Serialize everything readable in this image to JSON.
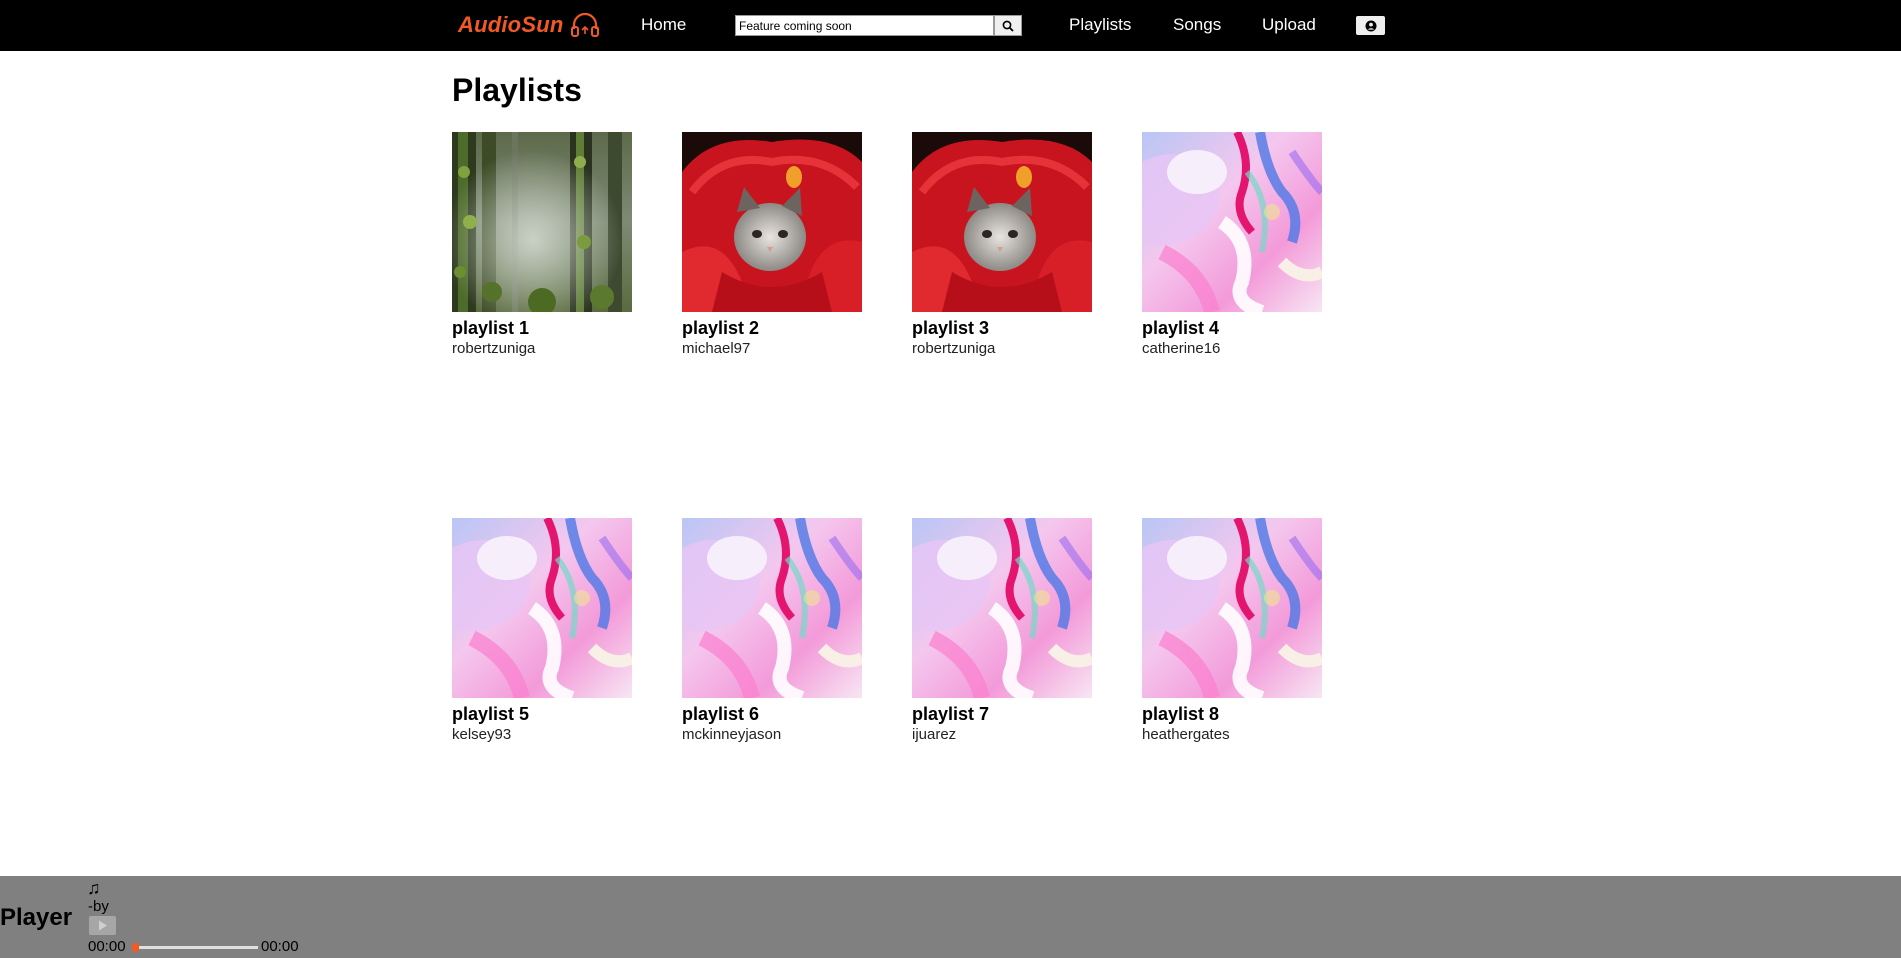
{
  "header": {
    "brand": "AudioSun",
    "nav_home": "Home",
    "search_placeholder": "Feature coming soon",
    "nav_playlists": "Playlists",
    "nav_songs": "Songs",
    "nav_upload": "Upload",
    "brand_color": "#f15a24"
  },
  "main": {
    "title": "Playlists",
    "playlists": [
      {
        "title": "playlist 1",
        "owner": "robertzuniga",
        "cover": "forest"
      },
      {
        "title": "playlist 2",
        "owner": "michael97",
        "cover": "cat-red-blanket"
      },
      {
        "title": "playlist 3",
        "owner": "robertzuniga",
        "cover": "cat-red-blanket"
      },
      {
        "title": "playlist 4",
        "owner": "catherine16",
        "cover": "marble-pastel"
      },
      {
        "title": "playlist 5",
        "owner": "kelsey93",
        "cover": "marble-pastel"
      },
      {
        "title": "playlist 6",
        "owner": "mckinneyjason",
        "cover": "marble-pastel"
      },
      {
        "title": "playlist 7",
        "owner": "ijuarez",
        "cover": "marble-pastel"
      },
      {
        "title": "playlist 8",
        "owner": "heathergates",
        "cover": "marble-pastel"
      }
    ]
  },
  "player": {
    "label": "Player",
    "note_icon": "♫",
    "track_by": "-by",
    "time_current": "00:00",
    "time_total": "00:00",
    "progress": 0
  }
}
